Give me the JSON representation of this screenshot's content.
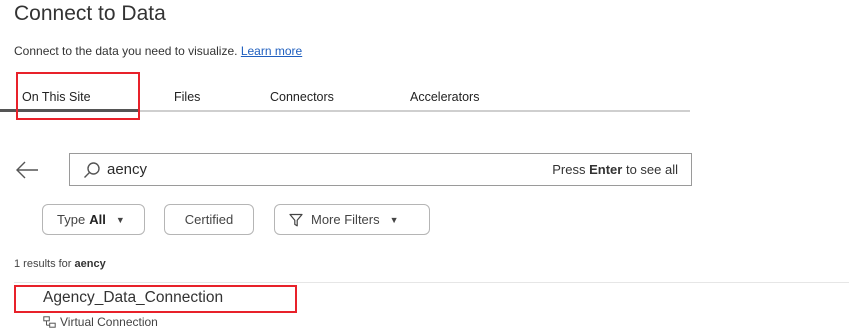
{
  "header": {
    "title": "Connect to Data",
    "subtitle": "Connect to the data you need to visualize.",
    "learn_more": "Learn more"
  },
  "tabs": [
    {
      "label": "On This Site",
      "active": true
    },
    {
      "label": "Files",
      "active": false
    },
    {
      "label": "Connectors",
      "active": false
    },
    {
      "label": "Accelerators",
      "active": false
    }
  ],
  "search": {
    "value": "aency",
    "hint_prefix": "Press",
    "hint_key": "Enter",
    "hint_suffix": "to see all"
  },
  "filters": {
    "type_label": "Type",
    "type_value": "All",
    "certified_label": "Certified",
    "more_filters_label": "More Filters"
  },
  "results": {
    "count_text": "1 results for",
    "query": "aency",
    "items": [
      {
        "name": "Agency_Data_Connection",
        "type": "Virtual Connection"
      }
    ]
  },
  "colors": {
    "highlight": "#e8212a",
    "link": "#1f5fbf",
    "active_tab_underline": "#555555"
  },
  "icons": {
    "back": "arrow-left-icon",
    "search": "search-icon",
    "filter": "funnel-icon",
    "caret": "caret-down-icon",
    "result_type": "virtual-connection-icon"
  }
}
